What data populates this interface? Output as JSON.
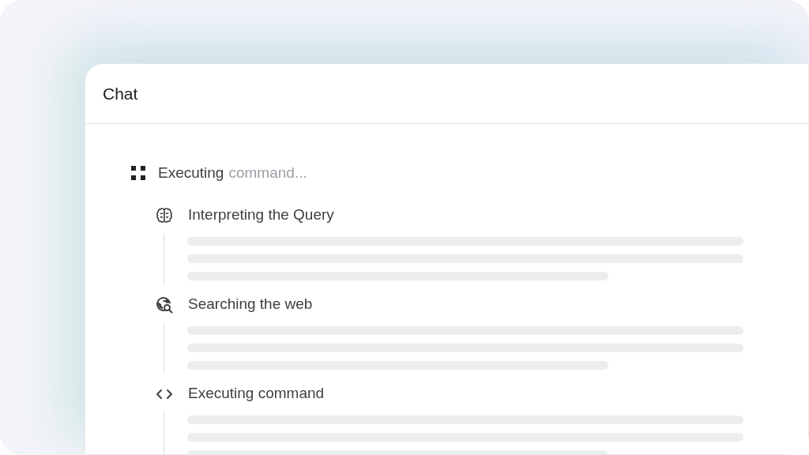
{
  "panel": {
    "title": "Chat"
  },
  "status": {
    "text": "Executing",
    "pending_text": "command..."
  },
  "steps": [
    {
      "kind": "brain",
      "title": "Interpreting the Query"
    },
    {
      "kind": "globe-search",
      "title": "Searching the web"
    },
    {
      "kind": "code",
      "title": "Executing command"
    }
  ]
}
